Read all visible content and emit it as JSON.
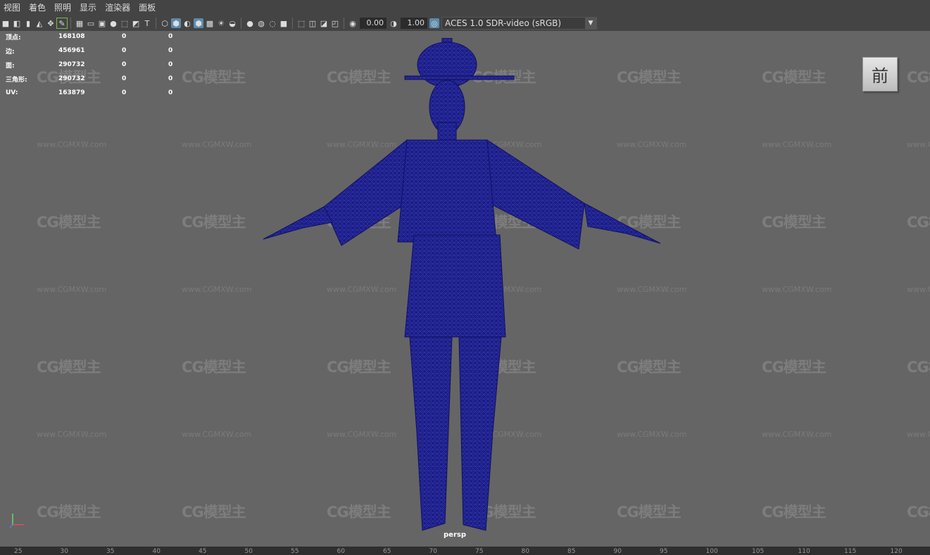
{
  "menu": [
    "视图",
    "着色",
    "照明",
    "显示",
    "渲染器",
    "面板"
  ],
  "toolbar": {
    "exposure": "0.00",
    "gamma": "1.00",
    "colorspace": "ACES 1.0 SDR-video (sRGB)"
  },
  "hud": [
    {
      "label": "顶点:",
      "value": "168108",
      "a": "0",
      "b": "0"
    },
    {
      "label": "边:",
      "value": "456961",
      "a": "0",
      "b": "0"
    },
    {
      "label": "面:",
      "value": "290732",
      "a": "0",
      "b": "0"
    },
    {
      "label": "三角形:",
      "value": "290732",
      "a": "0",
      "b": "0"
    },
    {
      "label": "UV:",
      "value": "163879",
      "a": "0",
      "b": "0"
    }
  ],
  "viewcube_label": "前",
  "camera": "persp",
  "watermark_logo": "CG模型主",
  "watermark_url": "www.CGMXW.com",
  "ruler_ticks": [
    "25",
    "30",
    "35",
    "40",
    "45",
    "50",
    "55",
    "60",
    "65",
    "70",
    "75",
    "80",
    "85",
    "90",
    "95",
    "100",
    "105",
    "110",
    "115",
    "120"
  ],
  "colors": {
    "mesh": "#1a1c86",
    "viewport": "#656565",
    "accent": "#5a8cae"
  }
}
